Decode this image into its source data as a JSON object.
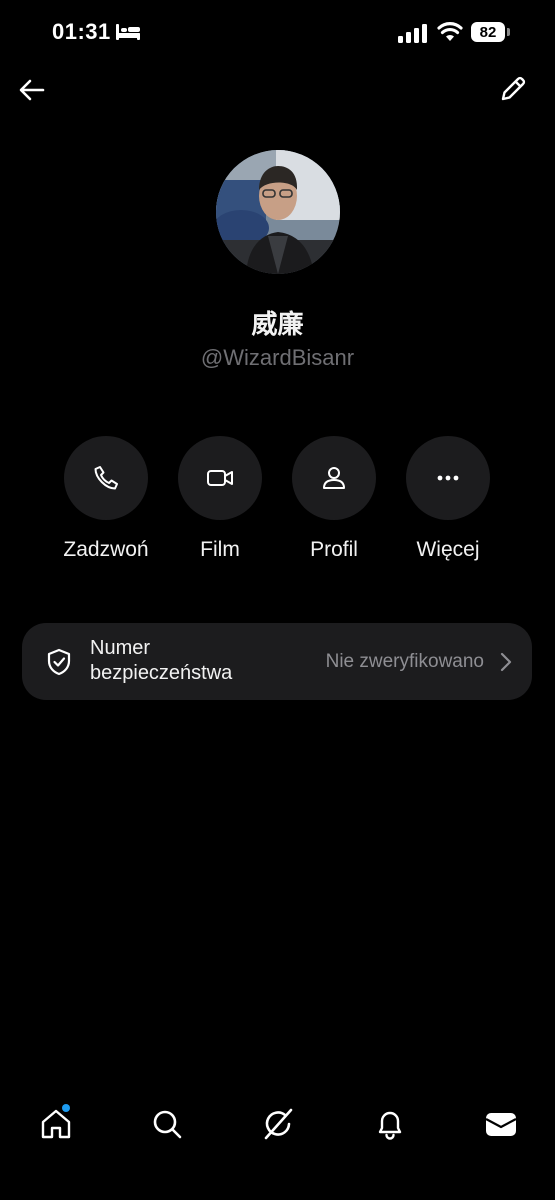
{
  "status_bar": {
    "time": "01:31",
    "battery": "82",
    "icons": [
      "bed-icon",
      "cellular-signal-icon",
      "wifi-icon",
      "battery-icon"
    ]
  },
  "header": {
    "back_icon": "arrow-left-icon",
    "edit_icon": "pencil-icon"
  },
  "profile": {
    "display_name": "威廉",
    "handle": "@WizardBisanr"
  },
  "actions": [
    {
      "label": "Zadzwoń",
      "icon": "phone-icon"
    },
    {
      "label": "Film",
      "icon": "video-camera-icon"
    },
    {
      "label": "Profil",
      "icon": "person-icon"
    },
    {
      "label": "Więcej",
      "icon": "more-dots-icon"
    }
  ],
  "safety": {
    "label": "Numer bezpieczeństwa",
    "status": "Nie zweryfikowano",
    "icon": "shield-check-icon"
  },
  "bottom_nav": [
    {
      "name": "home",
      "icon": "home-icon",
      "has_notification_dot": true
    },
    {
      "name": "search",
      "icon": "search-icon"
    },
    {
      "name": "grok",
      "icon": "grok-icon"
    },
    {
      "name": "notifications",
      "icon": "bell-icon"
    },
    {
      "name": "messages",
      "icon": "envelope-icon"
    }
  ],
  "colors": {
    "background": "#000000",
    "surface": "#1c1c1e",
    "secondary_text": "#8e8e93",
    "accent_dot": "#1d9bf0"
  }
}
